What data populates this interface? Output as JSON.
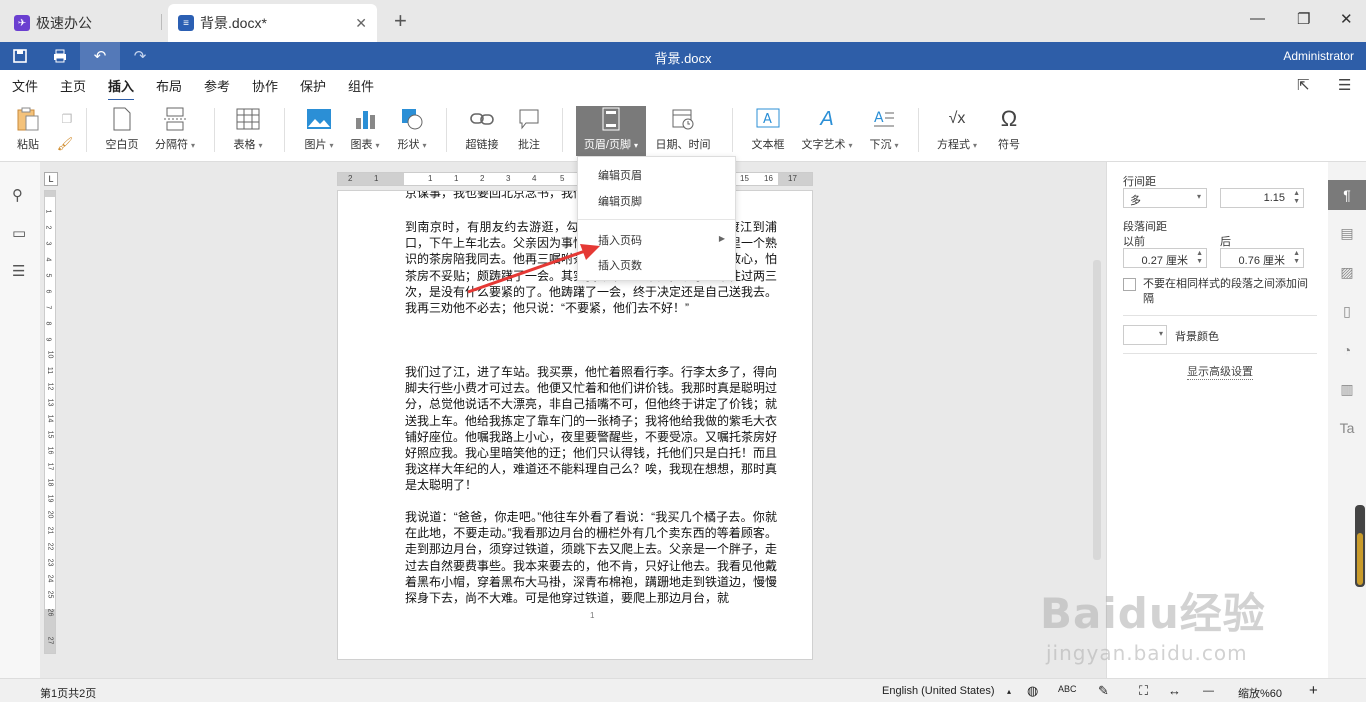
{
  "tabs": {
    "home_label": "极速办公",
    "doc_label": "背景.docx*",
    "close": "✕",
    "new": "+"
  },
  "window": {
    "minimize": "—",
    "restore": "❐",
    "close": "✕"
  },
  "titlebar": {
    "title": "背景.docx",
    "user": "Administrator"
  },
  "menu": {
    "items": [
      "文件",
      "主页",
      "插入",
      "布局",
      "参考",
      "协作",
      "保护",
      "组件"
    ],
    "active": "插入"
  },
  "ribbon": {
    "paste": "粘贴",
    "blank_page": "空白页",
    "separator": "分隔符",
    "table": "表格",
    "picture": "图片",
    "chart": "图表",
    "shape": "形状",
    "hyperlink": "超链接",
    "comment": "批注",
    "header_footer": "页眉/页脚",
    "datetime": "日期、时间",
    "textbox": "文本框",
    "wordart": "文字艺术",
    "dropcap": "下沉",
    "equation": "方程式",
    "symbol": "符号"
  },
  "dropdown": {
    "edit_header": "编辑页眉",
    "edit_footer": "编辑页脚",
    "insert_page_number": "插入页码",
    "insert_page_count": "插入页数"
  },
  "document": {
    "p0": "京谋事，我也要回北京念书，我们",
    "p1": "到南京时，有朋友约去游逛，勾留了一日；第二日上午便须渡江到浦口，下午上车北去。父亲因为事忙，本已说定不送我，叫旅馆里一个熟识的茶房陪我同去。他再三嘱咐茶房，甚是仔细。但他终于不放心，怕茶房不妥贴；颇踌躇了一会。其实我那年已二十岁，北京已来往过两三次，是没有什么要紧的了。他踌躇了一会，终于决定还是自己送我去。我再三劝他不必去；他只说：“不要紧，他们去不好！”",
    "p2": "我们过了江，进了车站。我买票，他忙着照看行李。行李太多了，得向脚夫行些小费才可过去。他便又忙着和他们讲价钱。我那时真是聪明过分，总觉他说话不大漂亮，非自己插嘴不可，但他终于讲定了价钱；就送我上车。他给我拣定了靠车门的一张椅子；我将他给我做的紫毛大衣铺好座位。他嘱我路上小心，夜里要警醒些，不要受凉。又嘱托茶房好好照应我。我心里暗笑他的迂；他们只认得钱，托他们只是白托！而且我这样大年纪的人，难道还不能料理自己么？唉，我现在想想，那时真是太聪明了！",
    "p3": "我说道：“爸爸，你走吧。”他往车外看了看说：“我买几个橘子去。你就在此地，不要走动。”我看那边月台的栅栏外有几个卖东西的等着顾客。走到那边月台，须穿过铁道，须跳下去又爬上去。父亲是一个胖子，走过去自然要费事些。我本来要去的，他不肯，只好让他去。我看见他戴着黑布小帽，穿着黑布大马褂，深青布棉袍，蹒跚地走到铁道边，慢慢探身下去，尚不大难。可是他穿过铁道，要爬上那边月台，就",
    "page_number": "1"
  },
  "ruler": {
    "h_numbers": [
      "2",
      "1",
      "1",
      "1",
      "2",
      "3",
      "4",
      "5",
      "6",
      "7",
      "15",
      "16",
      "17"
    ],
    "v_numbers": [
      "1",
      "2",
      "3",
      "4",
      "5",
      "6",
      "7",
      "8",
      "9",
      "10",
      "11",
      "12",
      "13",
      "14",
      "15",
      "16",
      "17",
      "18",
      "19",
      "20",
      "21",
      "22",
      "23",
      "24",
      "25",
      "26",
      "27"
    ],
    "corner": "L"
  },
  "panel": {
    "line_spacing_label": "行间距",
    "line_spacing_mode": "多",
    "line_spacing_value": "1.15",
    "para_spacing_label": "段落间距",
    "before_label": "以前",
    "after_label": "后",
    "before_value": "0.27 厘米",
    "after_value": "0.76 厘米",
    "no_space_label": "不要在相同样式的段落之间添加间隔",
    "bg_color_label": "背景颜色",
    "advanced_link": "显示高级设置"
  },
  "status": {
    "pages": "第1页共2页",
    "language": "English (United States)",
    "zoom": "缩放%60",
    "zoom_out": "—",
    "zoom_in": "+"
  },
  "watermark": {
    "brand": "Baidu经验",
    "url": "jingyan.baidu.com"
  },
  "colors": {
    "titlebar": "#2e5ea8",
    "selected_tool": "#7a7a7a",
    "arrow": "#e53935"
  }
}
